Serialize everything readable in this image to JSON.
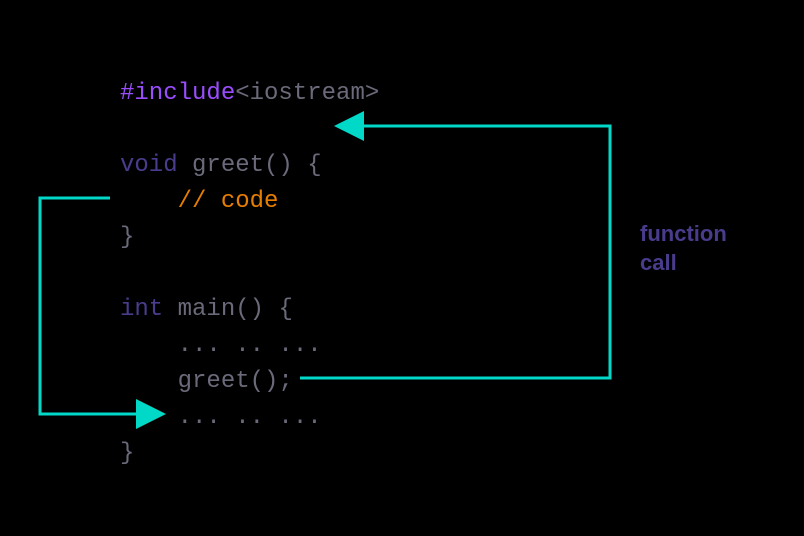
{
  "code": {
    "include_hash": "#include",
    "include_header": "<iostream>",
    "void_kw": "void",
    "greet_decl": " greet() {",
    "comment": "// code",
    "close_brace_1": "}",
    "int_kw": "int",
    "main_decl": " main() {",
    "ellipsis_1": "... .. ...",
    "call_greet": "greet();",
    "ellipsis_2": "... .. ...",
    "close_brace_2": "}"
  },
  "annotation": {
    "line1": "function",
    "line2": "call"
  },
  "colors": {
    "arrow": "#00d8c8"
  }
}
